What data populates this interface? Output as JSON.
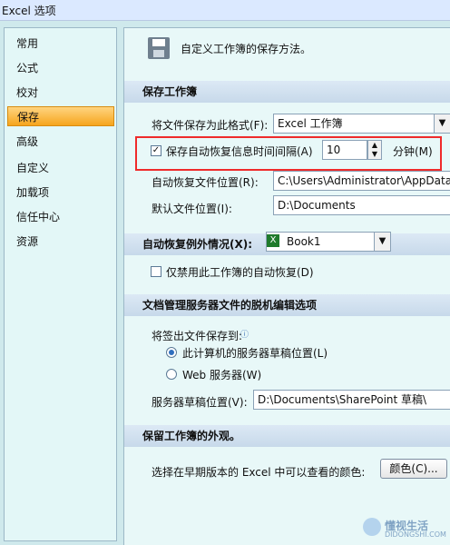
{
  "window": {
    "title": "Excel 选项"
  },
  "sidebar": {
    "items": [
      {
        "label": "常用"
      },
      {
        "label": "公式"
      },
      {
        "label": "校对"
      },
      {
        "label": "保存",
        "active": true
      },
      {
        "label": "高级"
      },
      {
        "label": "自定义"
      },
      {
        "label": "加载项"
      },
      {
        "label": "信任中心"
      },
      {
        "label": "资源"
      }
    ]
  },
  "header": {
    "title": "自定义工作簿的保存方法。",
    "icon": "save-icon"
  },
  "save_section": {
    "title": "保存工作簿",
    "format_label": "将文件保存为此格式(F):",
    "format_value": "Excel 工作簿",
    "autosave_checked": true,
    "autosave_label": "保存自动恢复信息时间间隔(A)",
    "autosave_value": "10",
    "autosave_unit": "分钟(M)",
    "autorecover_path_label": "自动恢复文件位置(R):",
    "autorecover_path_value": "C:\\Users\\Administrator\\AppData\\",
    "default_path_label": "默认文件位置(I):",
    "default_path_value": "D:\\Documents"
  },
  "autorecover_exceptions": {
    "title": "自动恢复例外情况(X):",
    "workbook": "Book1",
    "disable_label": "仅禁用此工作簿的自动恢复(D)",
    "disable_checked": false
  },
  "doc_mgmt": {
    "title": "文档管理服务器文件的脱机编辑选项",
    "checkout_label": "将签出文件保存到:",
    "info_icon": "info-icon",
    "option_local": "此计算机的服务器草稿位置(L)",
    "option_web": "Web 服务器(W)",
    "selected": "local",
    "draft_location_label": "服务器草稿位置(V):",
    "draft_location_value": "D:\\Documents\\SharePoint 草稿\\"
  },
  "appearance": {
    "title": "保留工作簿的外观。",
    "colors_label": "选择在早期版本的 Excel 中可以查看的颜色:",
    "colors_button": "颜色(C)..."
  },
  "watermark": {
    "text": "懂视生活",
    "sub": "DIDONGSHI.COM"
  },
  "colors": {
    "highlight": "#f6a51d",
    "redbox": "#ef2b2b"
  }
}
